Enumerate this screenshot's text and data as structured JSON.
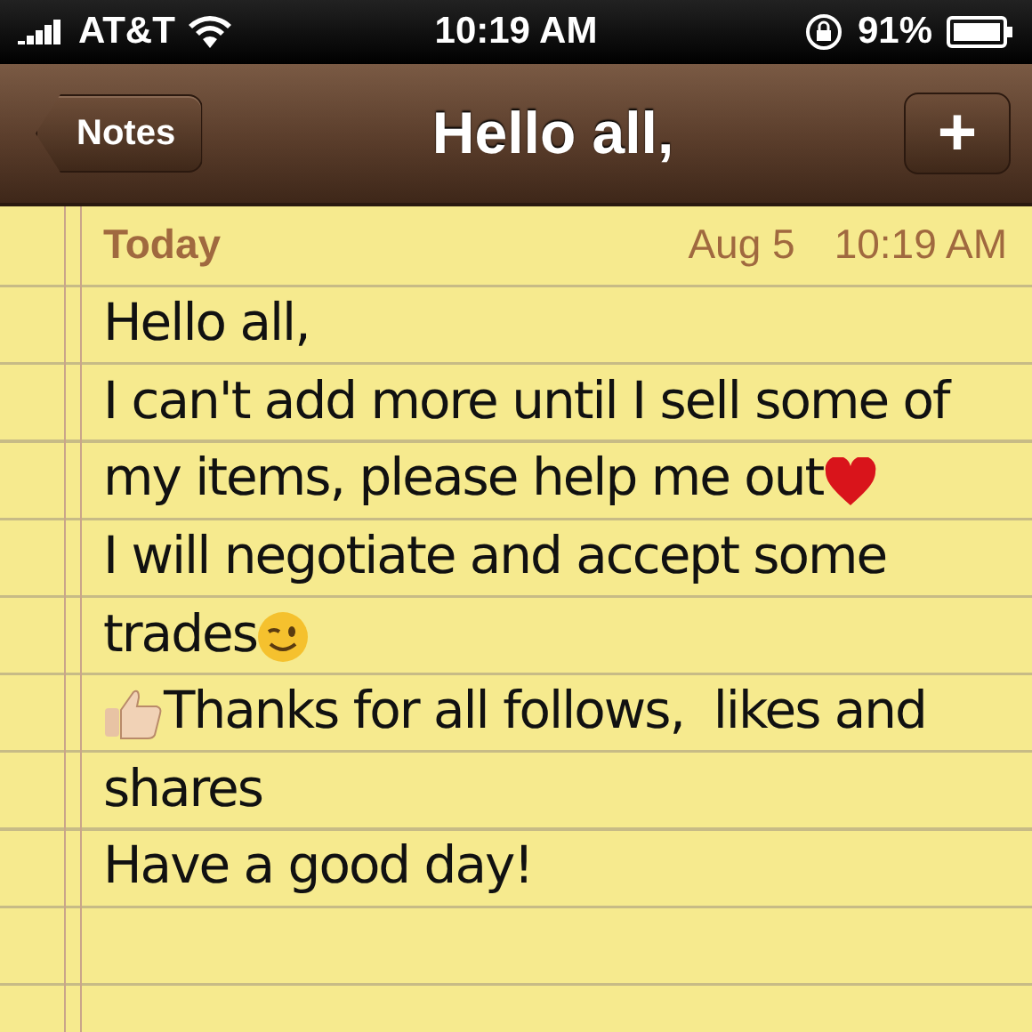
{
  "status_bar": {
    "carrier": "AT&T",
    "time": "10:19 AM",
    "battery": "91%"
  },
  "nav_bar": {
    "back": "Notes",
    "title": "Hello all,",
    "add": "+"
  },
  "note": {
    "day": "Today",
    "date": "Aug 5",
    "time": "10:19 AM",
    "lines": [
      {
        "kind": "plain",
        "text": "Hello all,"
      },
      {
        "kind": "plain",
        "text": "I can't add more until I sell some of"
      },
      {
        "kind": "heart",
        "text": "my items, please help me out"
      },
      {
        "kind": "plain",
        "text": "I will negotiate and accept some"
      },
      {
        "kind": "wink",
        "text": "trades"
      },
      {
        "kind": "thumbs",
        "text": "Thanks for all follows,  likes and"
      },
      {
        "kind": "plain",
        "text": "shares"
      },
      {
        "kind": "plain",
        "text": "Have a good day!"
      }
    ]
  }
}
